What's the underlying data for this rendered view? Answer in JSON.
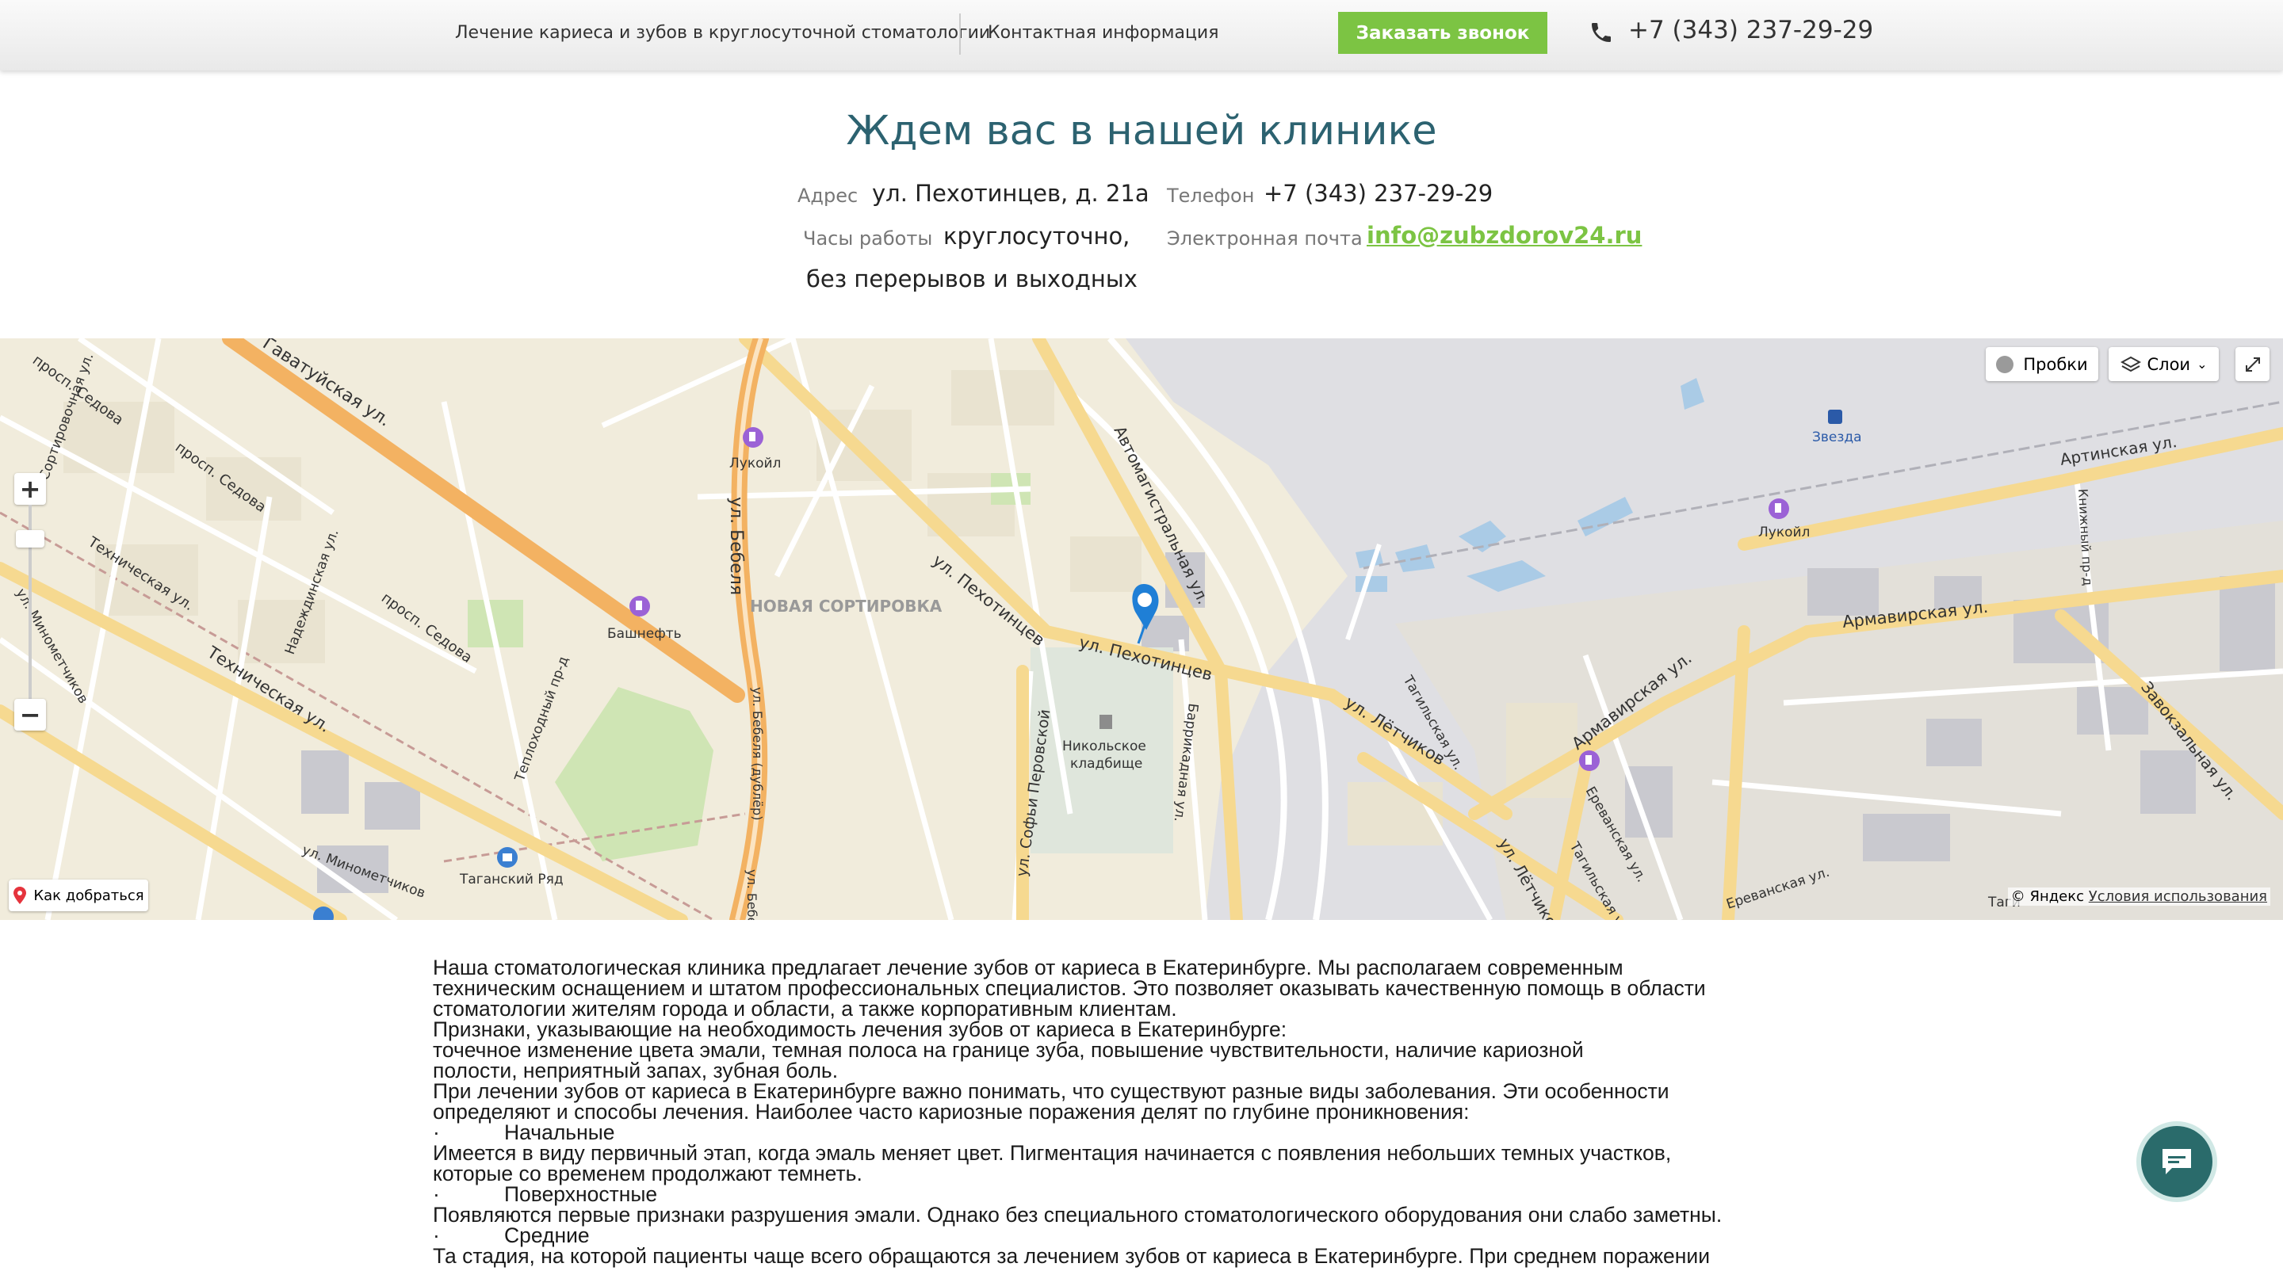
{
  "header": {
    "nav_treatment": "Лечение кариеса и зубов в круглосуточной стоматологии",
    "nav_contacts": "Контактная информация",
    "callback_label": "Заказать звонок",
    "phone": "+7 (343) 237-29-29"
  },
  "clinic": {
    "title": "Ждем вас в нашей клинике",
    "address_label": "Адрес",
    "address": "ул. Пехотинцев, д. 21а",
    "hours_label": "Часы работы",
    "hours_line1": "круглосуточно,",
    "hours_line2": "без перерывов и выходных",
    "phone_label": "Телефон",
    "phone": "+7 (343) 237-29-29",
    "email_label": "Электронная почта",
    "email": "info@zubzdorov24.ru"
  },
  "map": {
    "traffic_label": "Пробки",
    "layers_label": "Слои",
    "route_label": "Как добраться",
    "copyright": "© Яндекс",
    "terms_label": "Условия использования",
    "labels": {
      "gavatuyskaya": "Гаватуйская ул.",
      "sedova1": "просп. Седова",
      "sedova2": "просп. Седова",
      "sedova3": "просп. Седова",
      "sortirovochnaya": "Сортировочная ул.",
      "tekhnicheskaya1": "Техническая ул.",
      "tekhnicheskaya2": "Техническая ул.",
      "minometchikov1": "ул. Минометчиков",
      "minometchikov2": "ул. Минометчиков",
      "nadezhdinskaya": "Надеждинская ул.",
      "teplokhodny": "Теплоходный пр-д",
      "bashneft": "Башнефть",
      "lukoil1": "Лукойл",
      "lukoil2": "Лукойл",
      "belelya": "ул. Бебеля",
      "belelya_dubler": "ул. Бебеля (дублёр)",
      "belelya_short": "ул. Бебеля",
      "novaya_sortirovka": "НОВАЯ СОРТИРОВКА",
      "pekhotintsev1": "ул. Пехотинцев",
      "pekhotintsev2": "ул. Пехотинцев",
      "avtomagistralnaya": "Автомагистральная ул.",
      "letchikov1": "ул. Лётчиков",
      "letchikov2": "ул. Лётчиков",
      "sofyi_perovskoy": "ул. Софьи Перовской",
      "barrikadnaya": "Баррикадная ул.",
      "nikolskoe1": "Никольское",
      "nikolskoe2": "кладбище",
      "tagansky": "Таганский Ряд",
      "zvezda": "Звезда",
      "artinskaya": "Артинская ул.",
      "knizhny": "Книжный пр-д",
      "armavirskaya1": "Армавирская ул.",
      "armavirskaya2": "Армавирская ул.",
      "tagilskaya1": "Тагильская ул.",
      "tagilskaya2": "Тагильская ул.",
      "erevanskaya1": "Ереванская ул.",
      "erevanskaya2": "Ереванская ул.",
      "zavokzalnaya": "Завокзальная ул.",
      "tagi": "Таги"
    }
  },
  "article": {
    "p1_l1": "Наша стоматологическая клиника предлагает лечение зубов от кариеса в Екатеринбурге. Мы располагаем современным",
    "p1_l2": "техническим оснащением и штатом профессиональных специалистов. Это позволяет оказывать качественную помощь в области",
    "p1_l3": "стоматологии жителям города и области, а также корпоративным клиентам.",
    "p2": "Признаки, указывающие на необходимость лечения зубов от кариеса в Екатеринбурге:",
    "p3_l1": "точечное изменение цвета эмали, темная полоса на границе зуба, повышение чувствительности, наличие кариозной",
    "p3_l2": "полости, неприятный запах, зубная боль.",
    "p4_l1": "При лечении зубов от кариеса в Екатеринбурге важно понимать, что существуют разные виды заболевания. Эти особенности",
    "p4_l2": "определяют и способы лечения. Наиболее часто кариозные поражения делят по глубине проникновения:",
    "bullet": "·",
    "b1": "Начальные",
    "p5_l1": "Имеется в виду первичный этап, когда эмаль меняет цвет. Пигментация начинается с появления небольших темных участков,",
    "p5_l2": "которые со временем продолжают темнеть.",
    "b2": "Поверхностные",
    "p6": "Появляются первые признаки разрушения эмали. Однако без специального стоматологического оборудования они слабо заметны.",
    "b3": "Средние",
    "p7": "Та стадия, на которой пациенты чаще всего обращаются за лечением зубов от кариеса в Екатеринбурге. При среднем поражении"
  },
  "colors": {
    "accent_green": "#7cc443",
    "title_teal": "#2c6270",
    "chat_teal": "#2a6b6b"
  }
}
